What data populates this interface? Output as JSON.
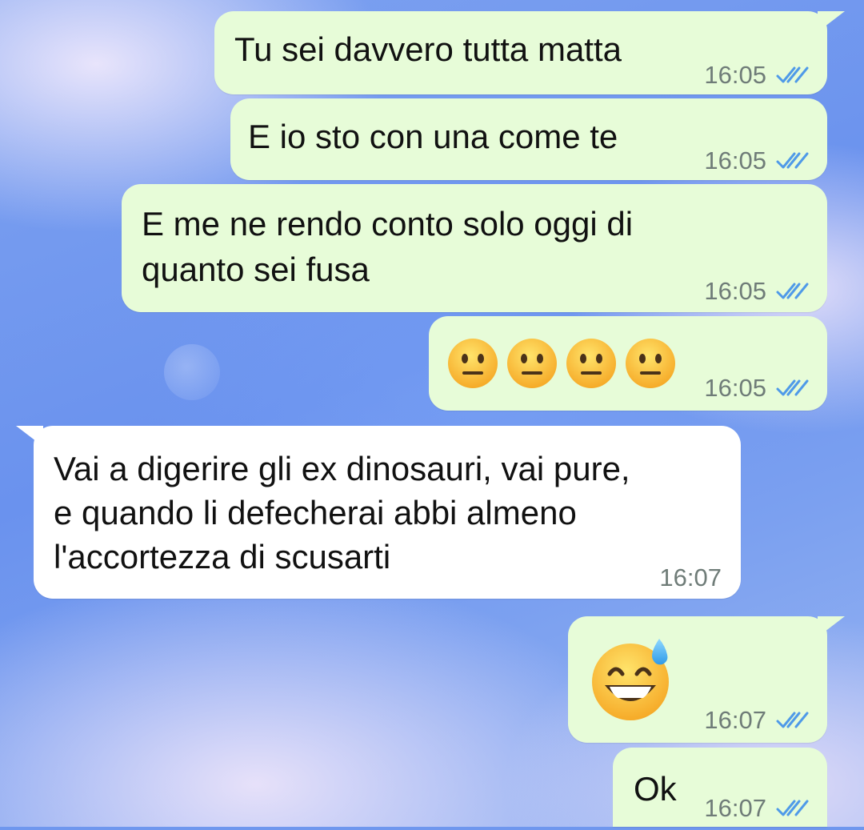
{
  "colors": {
    "outgoing_bubble": "#e7fcd8",
    "incoming_bubble": "#ffffff",
    "timestamp": "#6f7c78",
    "read_ticks": "#4f9ae8",
    "wallpaper": "#6f97ee"
  },
  "messages": [
    {
      "direction": "outgoing",
      "text": "Tu sei davvero tutta matta",
      "time": "16:05",
      "status": "read",
      "status_icon": "double-check-icon"
    },
    {
      "direction": "outgoing",
      "text": "E io sto con una come te",
      "time": "16:05",
      "status": "read",
      "status_icon": "double-check-icon"
    },
    {
      "direction": "outgoing",
      "lines": [
        "E me ne rendo conto solo oggi di",
        "quanto sei fusa"
      ],
      "time": "16:05",
      "status": "read",
      "status_icon": "double-check-icon"
    },
    {
      "direction": "outgoing",
      "emoji": [
        "neutral-face-emoji",
        "neutral-face-emoji",
        "neutral-face-emoji",
        "neutral-face-emoji"
      ],
      "time": "16:05",
      "status": "read",
      "status_icon": "double-check-icon"
    },
    {
      "direction": "incoming",
      "lines": [
        "Vai a digerire gli ex dinosauri, vai pure,",
        "e quando li defecherai abbi almeno",
        "l'accortezza di scusarti"
      ],
      "time": "16:07"
    },
    {
      "direction": "outgoing",
      "emoji": [
        "grinning-face-with-sweat-emoji"
      ],
      "time": "16:07",
      "status": "read",
      "status_icon": "double-check-icon"
    },
    {
      "direction": "outgoing",
      "text": "Ok",
      "time": "16:07",
      "status": "read",
      "status_icon": "double-check-icon"
    }
  ]
}
